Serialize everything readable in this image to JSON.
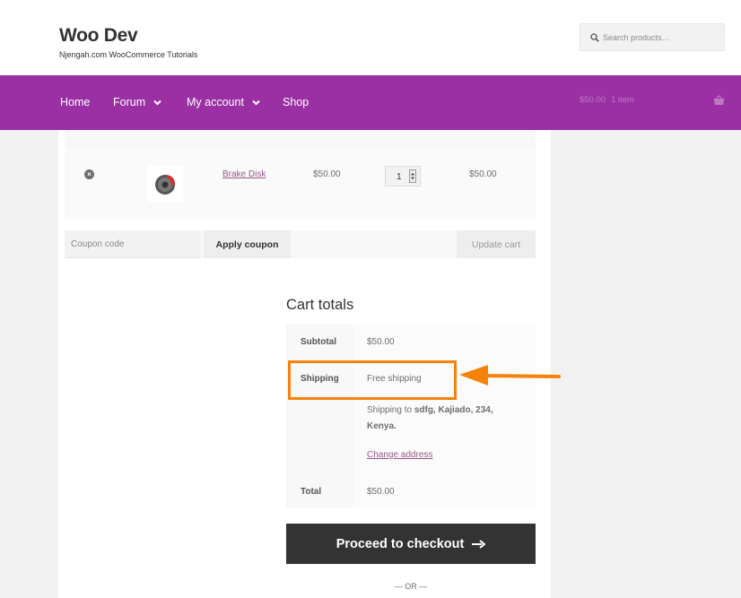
{
  "site": {
    "title": "Woo Dev",
    "description": "Njengah.com WooCommerce Tutorials"
  },
  "search": {
    "placeholder": "Search products…"
  },
  "nav": {
    "items": [
      {
        "label": "Home"
      },
      {
        "label": "Forum"
      },
      {
        "label": "My account"
      },
      {
        "label": "Shop"
      }
    ],
    "cart": {
      "amount": "$50.00",
      "count": "1 item"
    }
  },
  "cart": {
    "item": {
      "remove_glyph": "×",
      "name": "Brake Disk",
      "price": "$50.00",
      "quantity": "1",
      "subtotal": "$50.00"
    },
    "coupon_placeholder": "Coupon code",
    "apply_label": "Apply coupon",
    "update_label": "Update cart"
  },
  "totals": {
    "title": "Cart totals",
    "subtotal_label": "Subtotal",
    "subtotal_value": "$50.00",
    "shipping_label": "Shipping",
    "shipping_value": "Free shipping",
    "shipping_to_prefix": "Shipping to ",
    "shipping_to_address": "sdfg, Kajiado, 234, Kenya",
    "shipping_to_suffix": ".",
    "change_address": "Change address",
    "total_label": "Total",
    "total_value": "$50.00"
  },
  "checkout_label": "Proceed to checkout",
  "or_text": "— OR —",
  "colors": {
    "nav_bg": "#9b30a4",
    "link": "#96588a",
    "highlight": "#f7820b",
    "checkout_bg": "#333333"
  }
}
